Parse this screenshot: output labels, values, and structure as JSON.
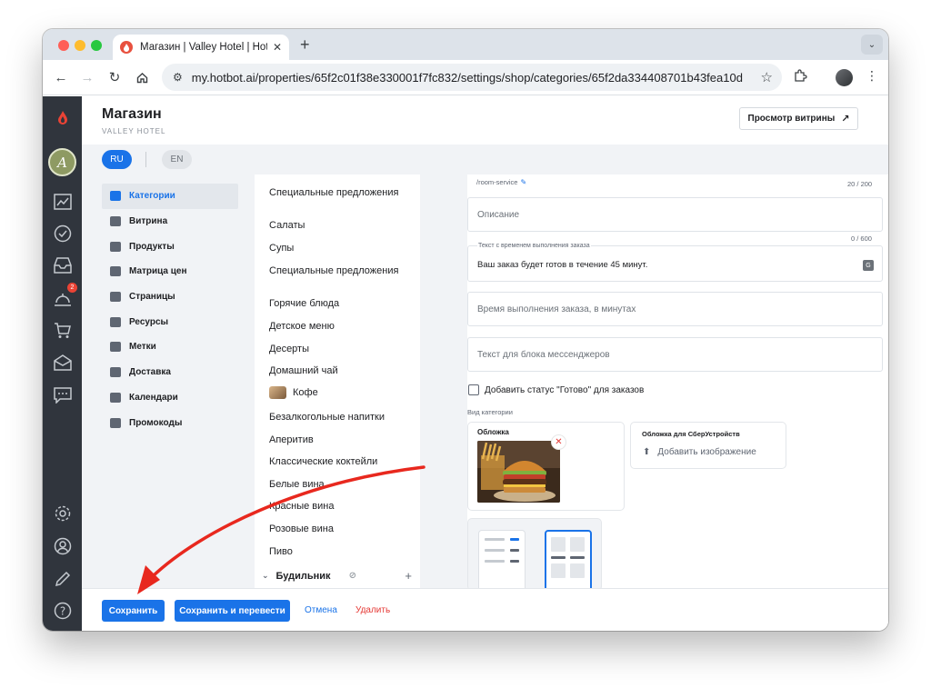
{
  "browser": {
    "tab_title": "Магазин | Valley Hotel | Hotbot",
    "url": "my.hotbot.ai/properties/65f2c01f38e330001f7fc832/settings/shop/categories/65f2da334408701b43fea10d"
  },
  "header": {
    "title": "Магазин",
    "subtitle": "VALLEY HOTEL",
    "preview_button": "Просмотр витрины"
  },
  "languages": {
    "ru": "RU",
    "en": "EN"
  },
  "leftbar": {
    "notifications_badge": "2"
  },
  "menu": [
    {
      "label": "Категории",
      "icon": "store-icon"
    },
    {
      "label": "Витрина",
      "icon": "showcase-icon"
    },
    {
      "label": "Продукты",
      "icon": "products-icon"
    },
    {
      "label": "Матрица цен",
      "icon": "price-matrix-icon"
    },
    {
      "label": "Страницы",
      "icon": "pages-icon"
    },
    {
      "label": "Ресурсы",
      "icon": "resources-icon"
    },
    {
      "label": "Метки",
      "icon": "tag-icon"
    },
    {
      "label": "Доставка",
      "icon": "truck-icon"
    },
    {
      "label": "Календари",
      "icon": "calendar-icon"
    },
    {
      "label": "Промокоды",
      "icon": "promo-icon"
    }
  ],
  "categories": [
    "Специальные предложения",
    "Салаты",
    "Супы",
    "Специальные предложения",
    "Горячие блюда",
    "Детское меню",
    "Десерты",
    "Домашний чай",
    "Кофе",
    "Безалкогольные напитки",
    "Аперитив",
    "Классические коктейли",
    "Белые вина",
    "Красные вина",
    "Розовые вина",
    "Пиво"
  ],
  "category_group": "Будильник",
  "form": {
    "slug": "/room-service",
    "slug_counter": "20 / 200",
    "description_placeholder": "Описание",
    "order_text_counter": "0 / 600",
    "order_text_label": "Текст с временем выполнения заказа",
    "order_text_value": "Ваш заказ будет готов в течение 45 минут.",
    "order_time_placeholder": "Время выполнения заказа, в минутах",
    "messenger_placeholder": "Текст для блока мессенджеров",
    "ready_status_label": "Добавить статус \"Готово\" для заказов",
    "view_label": "Вид категории",
    "cover_label": "Обложка",
    "sber_cover_label": "Обложка для СберУстройств",
    "add_image_label": "Добавить изображение"
  },
  "footer": {
    "save": "Сохранить",
    "save_translate": "Сохранить и перевести",
    "cancel": "Отмена",
    "delete": "Удалить"
  },
  "colors": {
    "primary": "#1a73e8",
    "danger": "#e53935",
    "sidebar": "#30353d",
    "annotation_arrow": "#e8281e"
  }
}
